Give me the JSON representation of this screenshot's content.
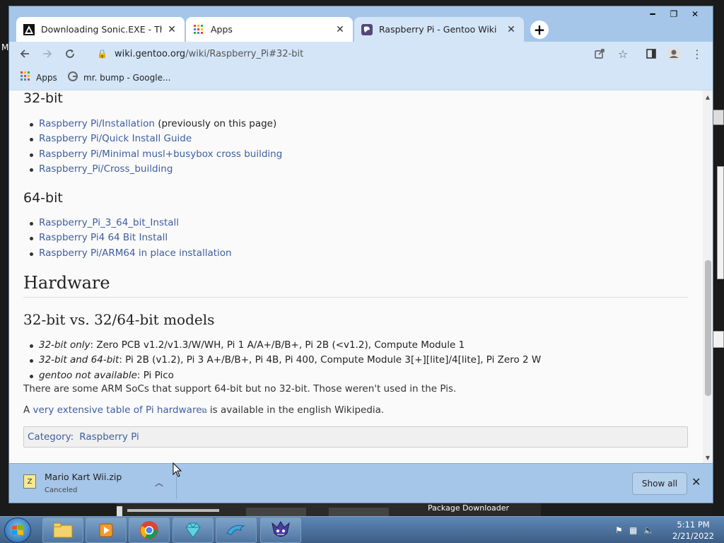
{
  "desktop": {
    "left_fragment": "M",
    "taskbar_label": "Package Downloader"
  },
  "browser": {
    "tabs": [
      {
        "title": "Downloading Sonic.EXE - The Ga",
        "favicon": "sonic-game-icon"
      },
      {
        "title": "Apps",
        "favicon": "apps-grid-icon"
      },
      {
        "title": "Raspberry Pi - Gentoo Wiki",
        "favicon": "gentoo-icon"
      }
    ],
    "address": {
      "host": "wiki.gentoo.org",
      "path": "/wiki/Raspberry_Pi#32-bit"
    },
    "bookmarks": [
      {
        "label": "Apps",
        "icon": "apps-grid-icon"
      },
      {
        "label": "mr. bump - Google...",
        "icon": "google-icon"
      }
    ]
  },
  "article": {
    "h_32bit": "32-bit",
    "list_32bit": [
      {
        "link": "Raspberry Pi/Installation",
        "after": " (previously on this page)"
      },
      {
        "link": "Raspberry Pi/Quick Install Guide",
        "after": ""
      },
      {
        "link": "Raspberry Pi/Minimal musl+busybox cross building",
        "after": ""
      },
      {
        "link": "Raspberry_Pi/Cross_building",
        "after": ""
      }
    ],
    "h_64bit": "64-bit",
    "list_64bit": [
      {
        "link": "Raspberry_Pi_3_64_bit_Install"
      },
      {
        "link": "Raspberry Pi4 64 Bit Install"
      },
      {
        "link": "Raspberry Pi/ARM64 in place installation"
      }
    ],
    "h_hardware": "Hardware",
    "h_models": "32-bit vs. 32/64-bit models",
    "models": [
      {
        "em": "32-bit only",
        "rest": ": Zero PCB v1.2/v1.3/W/WH, Pi 1 A/A+/B/B+, Pi 2B (<v1.2), Compute Module 1"
      },
      {
        "em": "32-bit and 64-bit",
        "rest": ": Pi 2B (v1.2), Pi 3 A+/B/B+, Pi 4B, Pi 400, Compute Module 3[+][lite]/4[lite], Pi Zero 2 W"
      },
      {
        "em": "gentoo not available",
        "rest": ": Pi Pico"
      }
    ],
    "para_soc": "There are some ARM SoCs that support 64-bit but no 32-bit. Those weren't used in the Pis.",
    "para_table_prefix": "A ",
    "para_table_link": "very extensive table of Pi hardware",
    "para_table_suffix": " is available in the english Wikipedia.",
    "category_label": "Category:",
    "category_value": "Raspberry Pi"
  },
  "download": {
    "filename": "Mario Kart Wii.zip",
    "status": "Canceled",
    "show_all": "Show all"
  },
  "taskbar": {
    "time": "5:11 PM",
    "date": "2/21/2022"
  }
}
